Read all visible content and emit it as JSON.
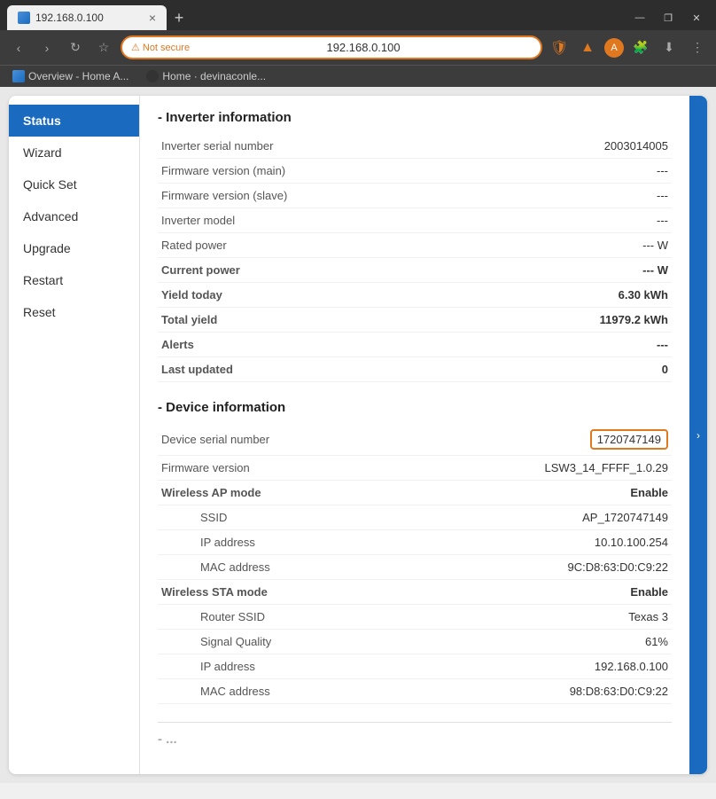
{
  "browser": {
    "tab": {
      "favicon_color": "#e77",
      "title": "192.168.0.100",
      "close": "×"
    },
    "new_tab": "+",
    "window_controls": [
      "—",
      "❐",
      "×"
    ],
    "nav": {
      "back": "‹",
      "forward": "›",
      "reload": "↻",
      "bookmark": "☆"
    },
    "address_bar": {
      "not_secure_label": "Not secure",
      "url": "192.168.0.100",
      "warning_icon": "⚠"
    },
    "bookmarks": [
      {
        "label": "Overview - Home A...",
        "type": "home"
      },
      {
        "label": "Home · devinaconle...",
        "type": "gh"
      }
    ]
  },
  "sidebar": {
    "items": [
      {
        "label": "Status",
        "active": true
      },
      {
        "label": "Wizard",
        "active": false
      },
      {
        "label": "Quick Set",
        "active": false
      },
      {
        "label": "Advanced",
        "active": false
      },
      {
        "label": "Upgrade",
        "active": false
      },
      {
        "label": "Restart",
        "active": false
      },
      {
        "label": "Reset",
        "active": false
      }
    ]
  },
  "inverter_section": {
    "title": "- Inverter information",
    "rows": [
      {
        "label": "Inverter serial number",
        "value": "2003014005",
        "bold": false
      },
      {
        "label": "Firmware version (main)",
        "value": "---",
        "bold": false
      },
      {
        "label": "Firmware version (slave)",
        "value": "---",
        "bold": false
      },
      {
        "label": "Inverter model",
        "value": "---",
        "bold": false
      },
      {
        "label": "Rated power",
        "value": "--- W",
        "bold": false
      },
      {
        "label": "Current power",
        "value": "--- W",
        "bold": true
      },
      {
        "label": "Yield today",
        "value": "6.30 kWh",
        "bold": true
      },
      {
        "label": "Total yield",
        "value": "11979.2 kWh",
        "bold": true
      },
      {
        "label": "Alerts",
        "value": "---",
        "bold": true
      },
      {
        "label": "Last updated",
        "value": "0",
        "bold": true
      }
    ]
  },
  "device_section": {
    "title": "- Device information",
    "rows": [
      {
        "label": "Device serial number",
        "value": "1720747149",
        "bold": false,
        "highlight": true
      },
      {
        "label": "Firmware version",
        "value": "LSW3_14_FFFF_1.0.29",
        "bold": false,
        "highlight": false
      },
      {
        "label": "Wireless AP mode",
        "value": "Enable",
        "bold": true,
        "highlight": false
      }
    ],
    "ap_rows": [
      {
        "label": "SSID",
        "value": "AP_1720747149",
        "bold": false
      },
      {
        "label": "IP address",
        "value": "10.10.100.254",
        "bold": false
      },
      {
        "label": "MAC address",
        "value": "9C:D8:63:D0:C9:22",
        "bold": false
      }
    ],
    "sta_rows_header": {
      "label": "Wireless STA mode",
      "value": "Enable",
      "bold": true
    },
    "sta_rows": [
      {
        "label": "Router SSID",
        "value": "Texas 3",
        "bold": false
      },
      {
        "label": "Signal Quality",
        "value": "61%",
        "bold": false
      },
      {
        "label": "IP address",
        "value": "192.168.0.100",
        "bold": false
      },
      {
        "label": "MAC address",
        "value": "98:D8:63:D0:C9:22",
        "bold": false
      }
    ]
  }
}
